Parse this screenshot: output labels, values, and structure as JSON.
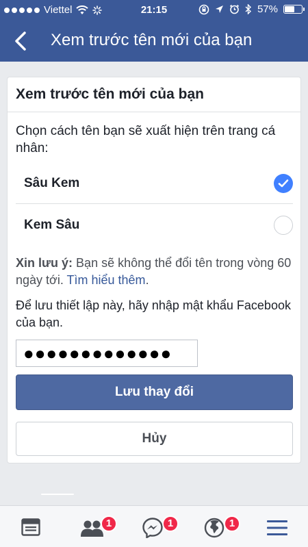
{
  "status_bar": {
    "carrier": "Viettel",
    "time": "21:15",
    "battery": "57%"
  },
  "nav": {
    "title": "Xem trước tên mới của bạn"
  },
  "card": {
    "header": "Xem trước tên mới của bạn",
    "description": "Chọn cách tên bạn sẽ xuất hiện trên trang cá nhân:",
    "options": [
      {
        "name": "Sâu Kem",
        "selected": true
      },
      {
        "name": "Kem Sâu",
        "selected": false
      }
    ],
    "note_label": "Xin lưu ý:",
    "note_text": " Bạn sẽ không thể đổi tên trong vòng 60 ngày tới. ",
    "note_link": "Tìm hiểu thêm",
    "note_end": ".",
    "password_prompt": "Để lưu thiết lập này, hãy nhập mật khẩu Facebook của bạn.",
    "password_value": "●●●●●●●●●●●●●",
    "save_label": "Lưu thay đổi",
    "cancel_label": "Hủy"
  },
  "tabbar": {
    "items": [
      {
        "icon": "news-feed-icon",
        "badge": ""
      },
      {
        "icon": "friend-requests-icon",
        "badge": "1"
      },
      {
        "icon": "messenger-icon",
        "badge": "1"
      },
      {
        "icon": "notifications-globe-icon",
        "badge": "1"
      },
      {
        "icon": "menu-icon",
        "badge": ""
      }
    ]
  },
  "colors": {
    "brand": "#3b5998",
    "button": "#4e69a2",
    "check": "#4080ff",
    "badge": "#f02849",
    "link": "#365899"
  }
}
